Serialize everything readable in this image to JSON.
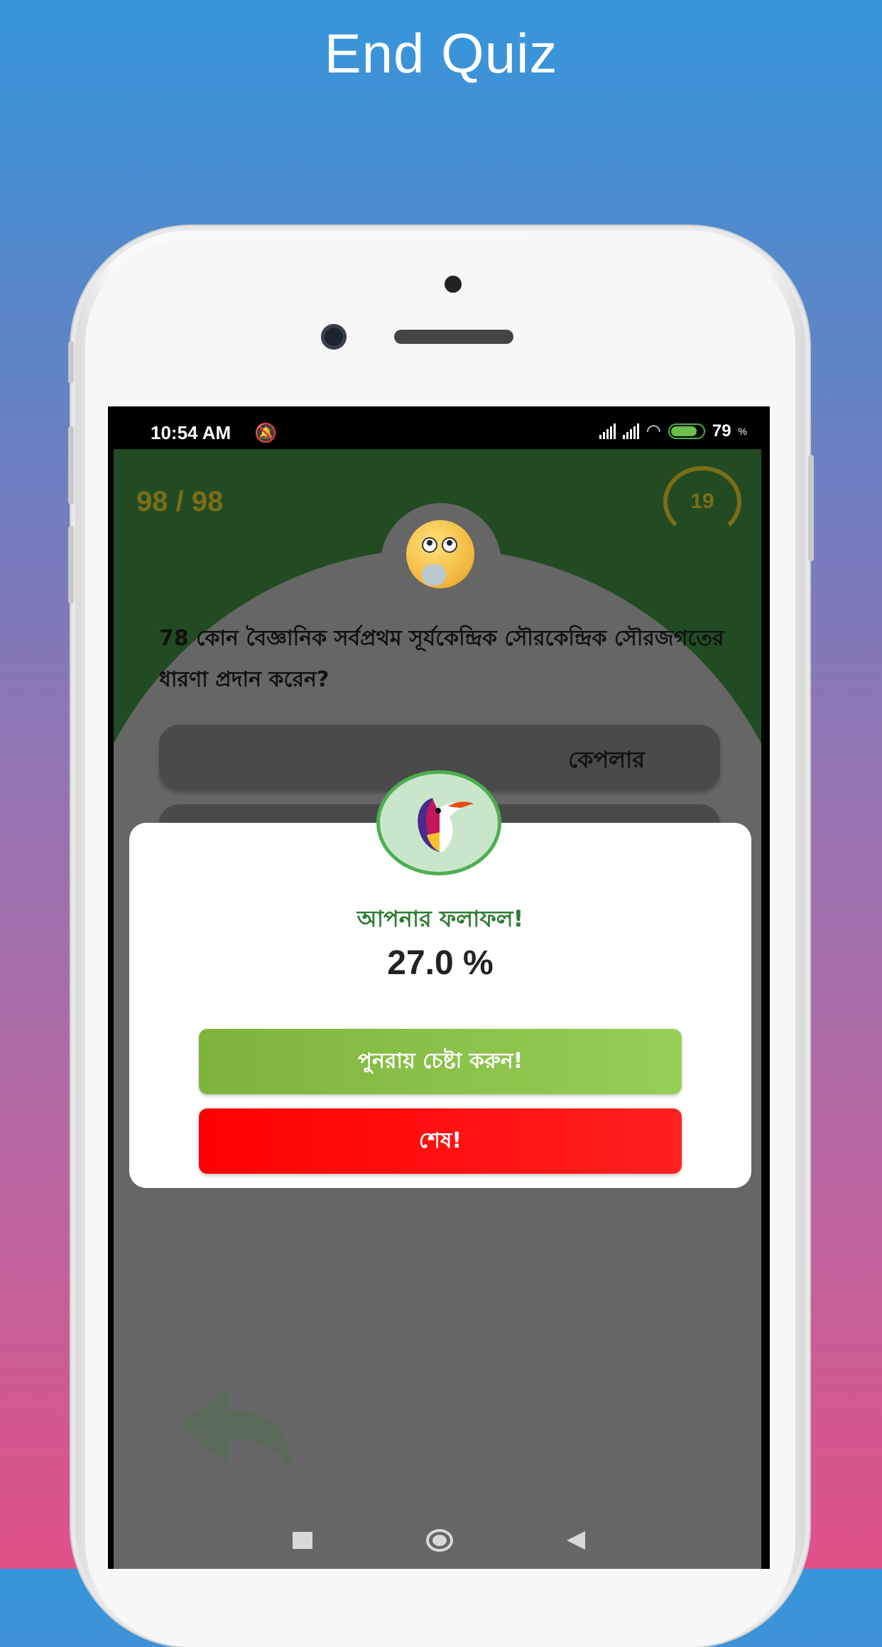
{
  "promo": {
    "title": "End Quiz"
  },
  "status_bar": {
    "time": "10:54 AM",
    "battery": "79",
    "battery_unit": "%"
  },
  "quiz": {
    "counter": "98 / 98",
    "timer": "19",
    "question": "78 কোন বৈজ্ঞানিক সর্বপ্রথম সূর্যকেন্দ্রিক সৌরকেন্দ্রিক সৌরজগতের ধারণা প্রদান করেন?",
    "options": [
      "কেপলার",
      ""
    ]
  },
  "dialog": {
    "title": "আপনার ফলাফল!",
    "score": "27.0 %",
    "retry_label": "পুনরায় চেষ্টা করুন!",
    "end_label": "শেষ!"
  },
  "colors": {
    "header_green": "#224b23",
    "accent_gold": "#7c6d17",
    "retry_green": "#8bc34a",
    "end_red": "#ff0000",
    "title_green": "#2e7d32"
  }
}
